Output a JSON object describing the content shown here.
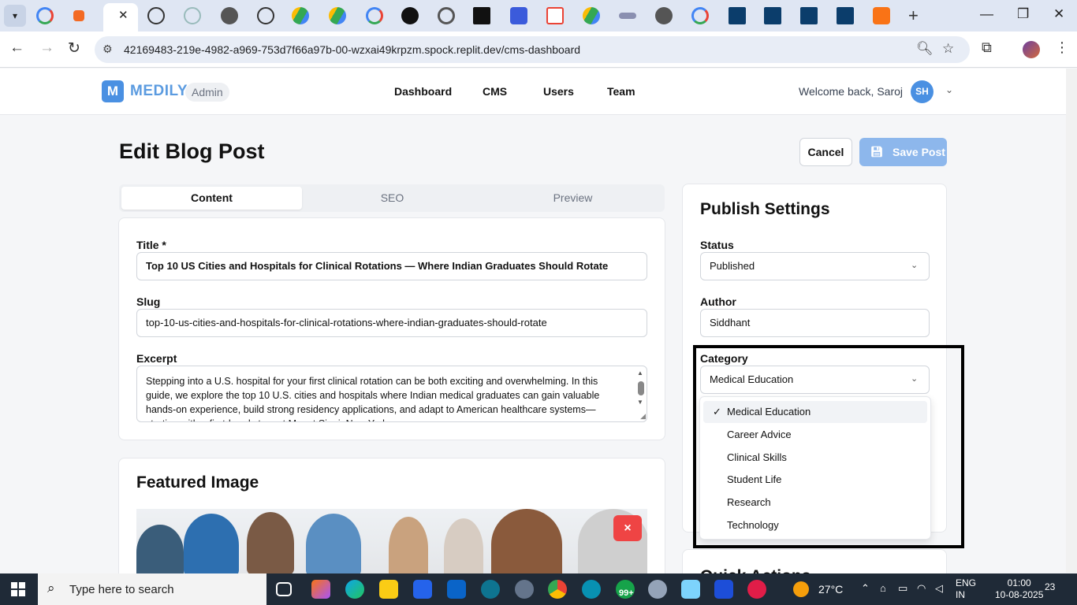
{
  "browser": {
    "url": "42169483-219e-4982-a969-753d7f66a97b-00-wzxai49krpzm.spock.replit.dev/cms-dashboard"
  },
  "app": {
    "logo_letter": "M",
    "brand": "MEDILY",
    "badge": "Admin",
    "nav": [
      "Dashboard",
      "CMS",
      "Users",
      "Team"
    ],
    "welcome": "Welcome back, Saroj",
    "avatar_initials": "SH"
  },
  "page": {
    "title": "Edit Blog Post",
    "cancel_label": "Cancel",
    "save_label": "Save Post"
  },
  "tabs": [
    "Content",
    "SEO",
    "Preview"
  ],
  "content": {
    "title_label": "Title *",
    "title_value": "Top 10 US Cities and Hospitals for Clinical Rotations — Where Indian Graduates Should Rotate",
    "slug_label": "Slug",
    "slug_value": "top-10-us-cities-and-hospitals-for-clinical-rotations-where-indian-graduates-should-rotate",
    "excerpt_label": "Excerpt",
    "excerpt_value": "Stepping into a U.S. hospital for your first clinical rotation can be both exciting and overwhelming. In this guide, we explore the top 10 U.S. cities and hospitals where Indian medical graduates can gain valuable hands-on experience, build strong residency applications, and adapt to American healthcare systems—starting with a first-hand story at Mount Sinai, New York."
  },
  "featured": {
    "title": "Featured Image",
    "remove_label": "×"
  },
  "publish": {
    "title": "Publish Settings",
    "status_label": "Status",
    "status_value": "Published",
    "author_label": "Author",
    "author_value": "Siddhant",
    "category_label": "Category",
    "category_value": "Medical Education",
    "category_options": [
      "Medical Education",
      "Career Advice",
      "Clinical Skills",
      "Student Life",
      "Research",
      "Technology"
    ]
  },
  "quick_actions": {
    "title": "Quick Actions"
  },
  "taskbar": {
    "search_placeholder": "Type here to search",
    "weather": "27°C",
    "lang_1": "ENG",
    "lang_2": "IN",
    "time": "01:00",
    "date": "10-08-2025",
    "badge_count": "99+",
    "notif_count": "23"
  },
  "colors": {
    "accent": "#4a90e2",
    "save_button": "#8db7ec",
    "danger": "#ef4444",
    "taskbar": "#1f2a37"
  }
}
